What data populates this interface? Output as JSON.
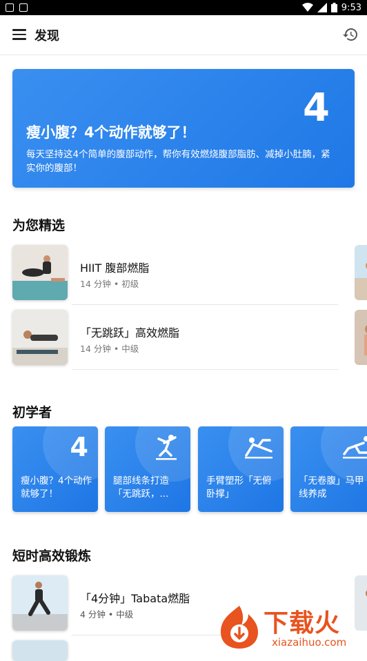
{
  "status_bar": {
    "time": "9:53"
  },
  "app_bar": {
    "title": "发现"
  },
  "hero": {
    "number": "4",
    "title": "瘦小腹？4个动作就够了！",
    "description": "每天坚持这4个简单的腹部动作，帮你有效燃烧腹部脂肪、减掉小肚腩，紧实你的腹部！"
  },
  "sections": {
    "featured": "为您精选",
    "beginner": "初学者",
    "short": "短时高效锻炼"
  },
  "featured_items": [
    {
      "name": "HIIT 腹部燃脂",
      "meta": "14 分钟 • 初级"
    },
    {
      "name": "「无跳跃」高效燃脂",
      "meta": "14 分钟 • 中级"
    }
  ],
  "beginner_cards": [
    {
      "number": "4",
      "label": "瘦小腹？4个动作就够了！"
    },
    {
      "label": "腿部线条打造「无跳跃，..."
    },
    {
      "label": "手臂塑形「无俯卧撑」"
    },
    {
      "label": "「无卷腹」马甲线养成"
    }
  ],
  "short_items": [
    {
      "name": "「4分钟」Tabata燃脂",
      "meta": "4 分钟 • 中级"
    }
  ],
  "watermark": {
    "text": "下载火",
    "url": "xiazaihuo.com"
  }
}
